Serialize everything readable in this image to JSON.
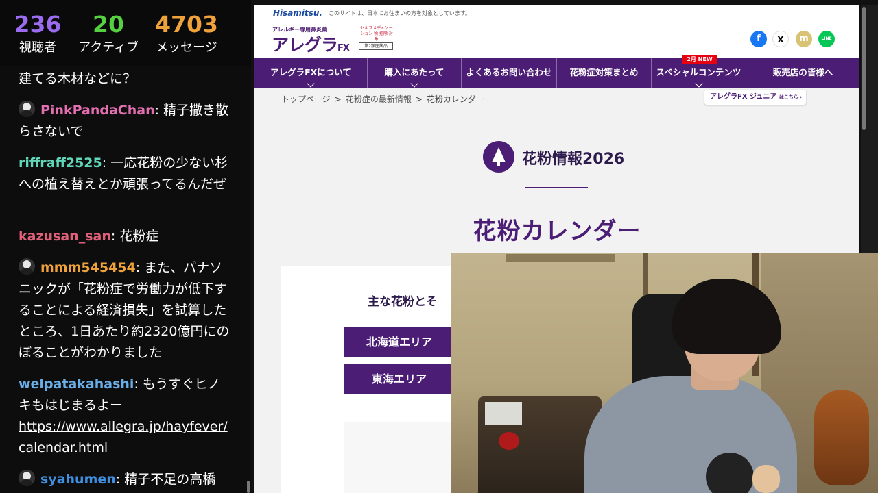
{
  "stats": {
    "viewers": {
      "value": "236",
      "label": "視聴者",
      "color": "#9b6bf0"
    },
    "active": {
      "value": "20",
      "label": "アクティブ",
      "color": "#56d040"
    },
    "messages": {
      "value": "4703",
      "label": "メッセージ",
      "color": "#f0a23a"
    }
  },
  "chat": [
    {
      "user": "",
      "text": "建てる木材などに？",
      "color": "#ffffff"
    },
    {
      "user": "PinkPandaChan",
      "text": "精子撒き散らさないで",
      "color": "#e46fb0"
    },
    {
      "user": "riffraff2525",
      "text": "一応花粉の少ない杉への植え替えとか頑張ってるんだぜ",
      "color": "#61d6b9"
    },
    {
      "user": "kazusan_san",
      "text": "花粉症",
      "color": "#e0607a"
    },
    {
      "user": "mmm545454",
      "text": "また、パナソニックが「花粉症で労働力が低下することによる経済損失」を試算したところ、1日あたり約2320億円にのぼることがわかりました",
      "color": "#f0a23a"
    },
    {
      "user": "welpatakahashi",
      "text": "もうすぐヒノキもはじまるよー",
      "link": "https://www.allegra.jp/hayfever/calendar.html",
      "color": "#6aaee8"
    },
    {
      "user": "syahumen",
      "text": "精子不足の高橋",
      "color": "#3f8fe0"
    }
  ],
  "site": {
    "company": "Hisamitsu.",
    "company_note": "このサイトは、日本にお住まいの方を対象としています。",
    "logo_small": "アレルギー専用鼻炎薬",
    "logo_main": "アレグラ",
    "logo_suffix": "FX",
    "self_med": "セルフメディケーション 税 控除 対象",
    "drug_class": "第2類医薬品",
    "nav": [
      "アレグラFXについて",
      "購入にあたって",
      "よくあるお問い合わせ",
      "花粉症対策まとめ",
      "スペシャルコンテンツ",
      "販売店の皆様へ"
    ],
    "new_tag": "2月 NEW",
    "breadcrumb": [
      "トップページ",
      "花粉症の最新情報",
      "花粉カレンダー"
    ],
    "breadcrumb_sep": ">",
    "junior": "アレグラFX ジュニア",
    "junior_small": "はこちら ›",
    "info_title": "花粉情報2026",
    "cal_title": "花粉カレンダー",
    "card_heading": "主な花粉とそ",
    "areas": [
      "北海道エリア",
      "東海エリア"
    ],
    "share_icons": [
      "f",
      "X",
      "m",
      "LINE"
    ]
  },
  "colors": {
    "brand_purple": "#4b1d75",
    "facebook": "#1877f2",
    "line": "#06c755",
    "new_red": "#e60012"
  }
}
